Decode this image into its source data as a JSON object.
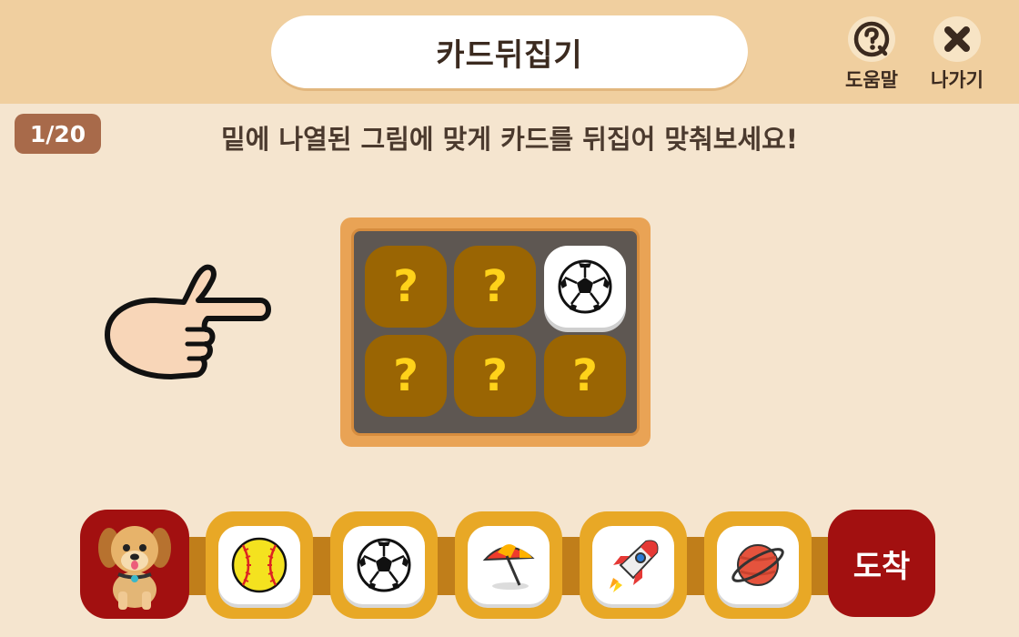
{
  "header": {
    "title": "카드뒤집기",
    "help_label": "도움말",
    "exit_label": "나가기"
  },
  "progress": {
    "counter": "1/20"
  },
  "instruction": "밑에 나열된 그림에 맞게 카드를 뒤집어 맞춰보세요!",
  "board": {
    "cards": [
      {
        "face": "?",
        "flipped": false
      },
      {
        "face": "?",
        "flipped": false
      },
      {
        "face": "soccer-ball-icon",
        "flipped": true
      },
      {
        "face": "?",
        "flipped": false
      },
      {
        "face": "?",
        "flipped": false
      },
      {
        "face": "?",
        "flipped": false
      }
    ]
  },
  "path": {
    "start_icon": "puppy-icon",
    "items": [
      "baseball-icon",
      "soccer-ball-icon",
      "beach-umbrella-icon",
      "rocket-icon",
      "planet-icon"
    ],
    "end_label": "도착"
  },
  "colors": {
    "background": "#f5e5cf",
    "topbar": "#f0cf9f",
    "card_back": "#9a6503",
    "card_question": "#ffd21a",
    "slot": "#e8a826",
    "track": "#c07e1a",
    "end_slot": "#a21010",
    "counter": "#a86a4a"
  }
}
